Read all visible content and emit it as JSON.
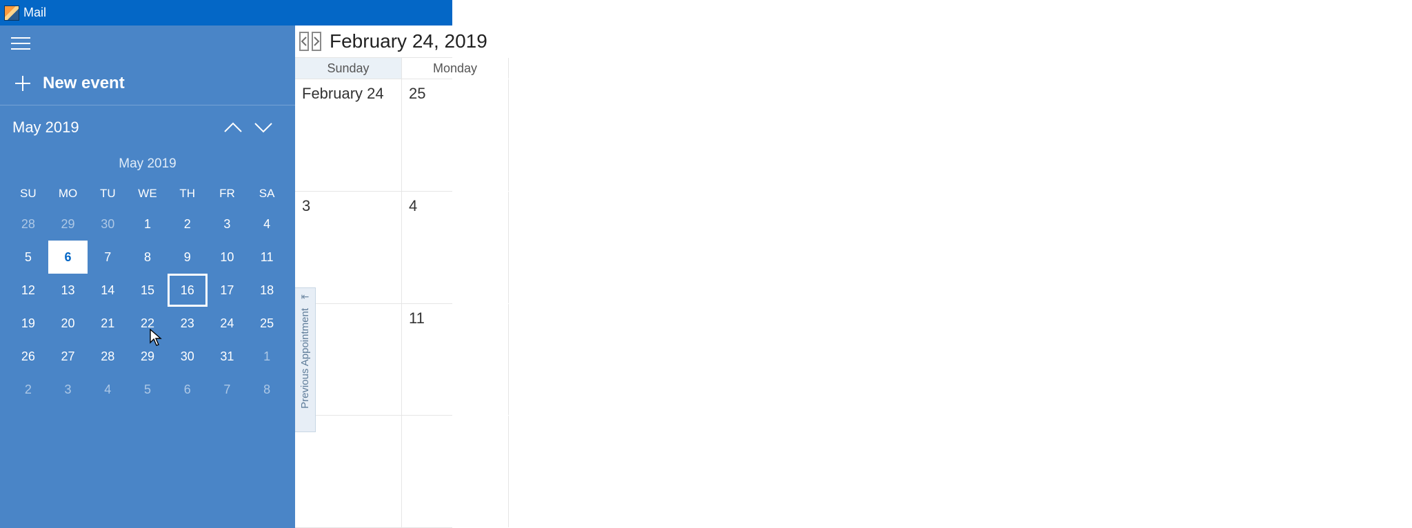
{
  "titlebar": {
    "app_name": "Mail"
  },
  "sidebar": {
    "new_event_label": "New event",
    "month_header_label": "May 2019",
    "mini_cal": {
      "title": "May 2019",
      "weekdays": [
        "SU",
        "MO",
        "TU",
        "WE",
        "TH",
        "FR",
        "SA"
      ],
      "today": 6,
      "selected": 16,
      "rows": [
        [
          {
            "n": 28,
            "dim": true
          },
          {
            "n": 29,
            "dim": true
          },
          {
            "n": 30,
            "dim": true
          },
          {
            "n": 1
          },
          {
            "n": 2
          },
          {
            "n": 3
          },
          {
            "n": 4
          }
        ],
        [
          {
            "n": 5
          },
          {
            "n": 6
          },
          {
            "n": 7
          },
          {
            "n": 8
          },
          {
            "n": 9
          },
          {
            "n": 10
          },
          {
            "n": 11
          }
        ],
        [
          {
            "n": 12
          },
          {
            "n": 13
          },
          {
            "n": 14
          },
          {
            "n": 15
          },
          {
            "n": 16
          },
          {
            "n": 17
          },
          {
            "n": 18
          }
        ],
        [
          {
            "n": 19
          },
          {
            "n": 20
          },
          {
            "n": 21
          },
          {
            "n": 22
          },
          {
            "n": 23
          },
          {
            "n": 24
          },
          {
            "n": 25
          }
        ],
        [
          {
            "n": 26
          },
          {
            "n": 27
          },
          {
            "n": 28
          },
          {
            "n": 29
          },
          {
            "n": 30
          },
          {
            "n": 31
          },
          {
            "n": 1,
            "dim": true
          }
        ],
        [
          {
            "n": 2,
            "dim": true
          },
          {
            "n": 3,
            "dim": true
          },
          {
            "n": 4,
            "dim": true
          },
          {
            "n": 5,
            "dim": true
          },
          {
            "n": 6,
            "dim": true
          },
          {
            "n": 7,
            "dim": true
          },
          {
            "n": 8,
            "dim": true
          }
        ]
      ]
    }
  },
  "main": {
    "date_label": "February 24, 2019",
    "columns": [
      "Sunday",
      "Monday"
    ],
    "rows": [
      [
        "February 24",
        "25"
      ],
      [
        "3",
        "4"
      ],
      [
        "",
        "11"
      ],
      [
        "",
        ""
      ]
    ],
    "prev_appt_label": "Previous Appointment"
  }
}
